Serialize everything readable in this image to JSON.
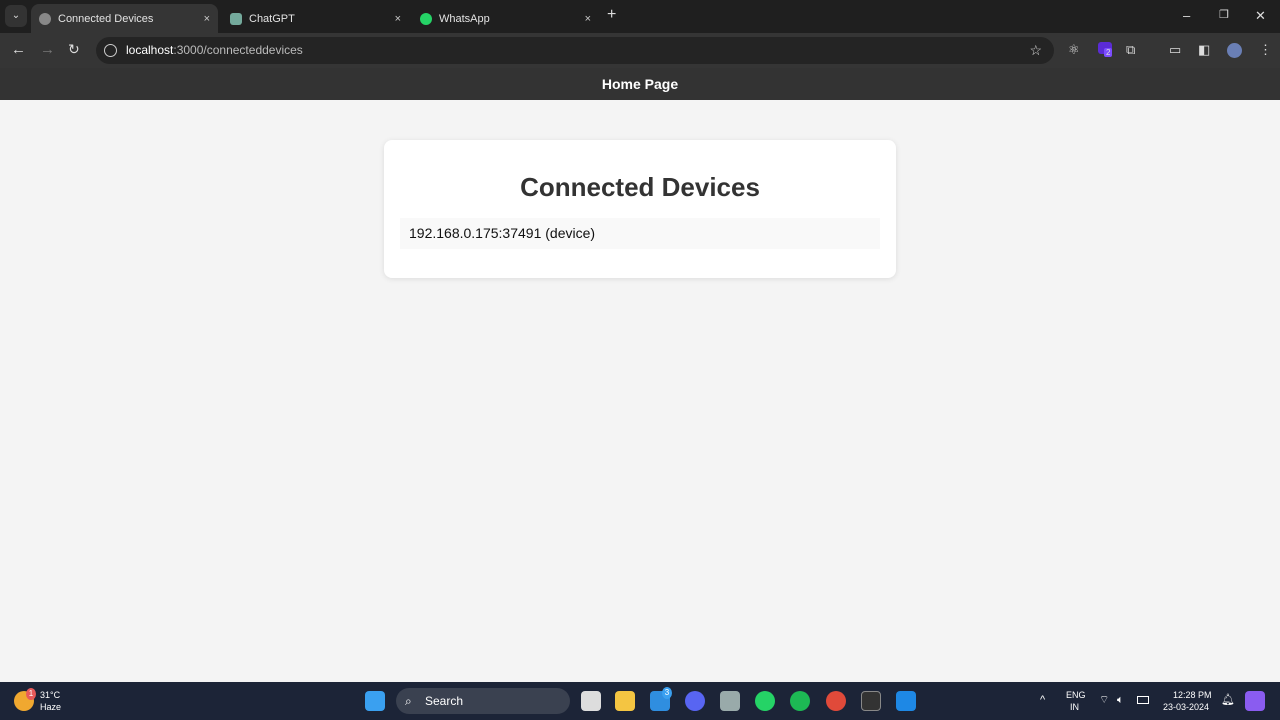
{
  "browser": {
    "tabs": [
      {
        "label": "Connected Devices",
        "active": true
      },
      {
        "label": "ChatGPT"
      },
      {
        "label": "WhatsApp"
      }
    ],
    "new_tab": "+",
    "close": "×",
    "url_host": "localhost",
    "url_rest": ":3000/connecteddevices",
    "extension_badge": "2"
  },
  "app": {
    "header": "Home Page",
    "title": "Connected Devices",
    "devices": [
      "192.168.0.175:37491 (device)"
    ]
  },
  "taskbar": {
    "weather_temp": "31°C",
    "weather_desc": "Haze",
    "weather_badge": "1",
    "search": "Search",
    "mail_badge": "3",
    "lang": "ENG",
    "region": "IN",
    "time": "12:28 PM",
    "date": "23-03-2024"
  }
}
